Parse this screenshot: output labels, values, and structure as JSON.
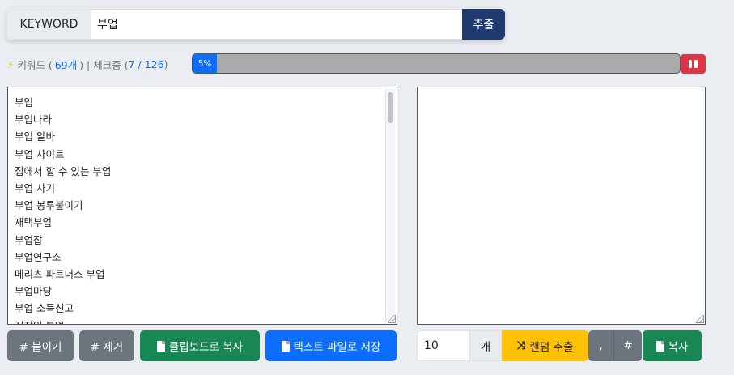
{
  "search": {
    "label": "KEYWORD",
    "value": "부업",
    "button": "추출"
  },
  "status": {
    "bolt": "⚡",
    "keyword_prefix": "키워드 (",
    "keyword_count": "69개",
    "keyword_suffix": ") | 체크중 (",
    "check_current": "7 / 126",
    "check_suffix": ")"
  },
  "progress": {
    "label": "5%",
    "value": 0.05
  },
  "keywords": [
    "부업",
    "부업나라",
    "부업 알바",
    "부업 사이트",
    "집에서 할 수 있는 부업",
    "부업 사기",
    "부업 봉투붙이기",
    "재택부업",
    "부업잡",
    "부업연구소",
    "메리츠 파트너스 부업",
    "부업마당",
    "부업 소득신고",
    "직장인 부업"
  ],
  "buttons": {
    "paste": "# 붙이기",
    "remove": "# 제거",
    "copy_clipboard": "클립보드로 복사",
    "save_text": "텍스트 파일로 저장",
    "random": "랜덤 추출",
    "comma": ",",
    "hash": "#",
    "copy": "복사"
  },
  "random_count": {
    "value": "10",
    "unit": "개"
  },
  "icons": {
    "shuffle": "⤨"
  },
  "colors": {
    "primary": "#0d6efd",
    "danger": "#dc3545",
    "success": "#198754",
    "warning": "#ffc107",
    "secondary": "#6c757d",
    "navy": "#1e3a6e"
  }
}
